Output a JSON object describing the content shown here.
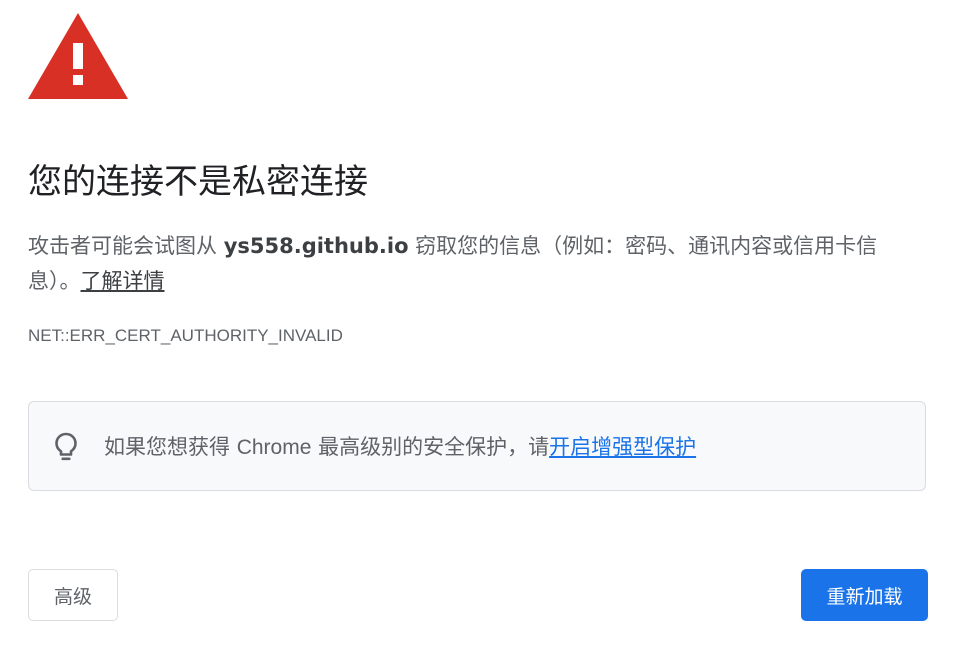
{
  "icons": {
    "warning": "warning-triangle-icon",
    "lightbulb": "lightbulb-icon"
  },
  "colors": {
    "warning_red": "#d93025",
    "link_blue": "#1a73e8",
    "primary_button": "#1a73e8",
    "promo_background": "#f8f9fa",
    "secondary_text": "#5f6368"
  },
  "heading": "您的连接不是私密连接",
  "explanation": {
    "prefix": "攻击者可能会试图从 ",
    "domain": "ys558.github.io",
    "suffix": " 窃取您的信息（例如：密码、通讯内容或信用卡信息）。",
    "learn_more": "了解详情"
  },
  "error_code": "NET::ERR_CERT_AUTHORITY_INVALID",
  "enhanced_protection_promo": {
    "text_before_brand": "如果您想获得 ",
    "brand": "Chrome",
    "text_after_brand": " 最高级别的安全保护，请",
    "link": "开启增强型保护"
  },
  "buttons": {
    "advanced": "高级",
    "reload": "重新加载"
  }
}
